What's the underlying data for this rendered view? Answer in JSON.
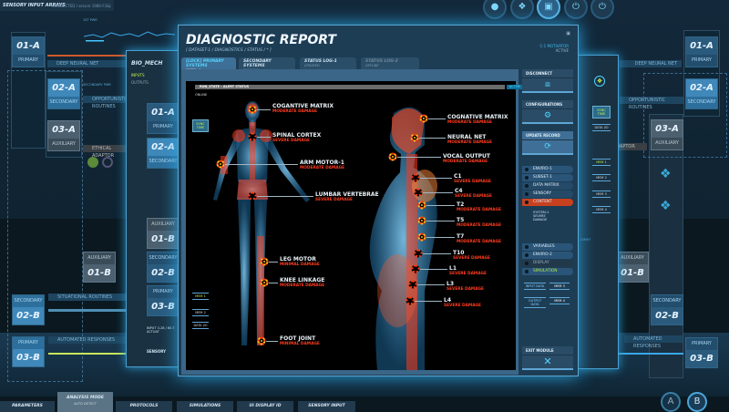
{
  "topbar": {
    "title": "SENSORY INPUT ARRAYS",
    "status": "CONNECTED / secure 1980-F3&J",
    "power_label": "1ST PWR"
  },
  "top_icons": [
    "user-icon",
    "diamond-icon",
    "document-icon",
    "power-icon",
    "power-icon"
  ],
  "left": {
    "tiles": [
      {
        "id": "01-A",
        "label": "PRIMARY"
      },
      {
        "id": "02-A",
        "label": "SECONDARY"
      },
      {
        "id": "03-A",
        "label": "AUXILIARY"
      },
      {
        "id": "01-B",
        "label": "AUXILIARY"
      },
      {
        "id": "02-B",
        "label": "SECONDARY"
      },
      {
        "id": "03-B",
        "label": "PRIMARY"
      }
    ],
    "strips": [
      "DEEP NEURAL NET",
      "OPPORTUNISTIC ROUTINES",
      "ETHICAL ADAPTOR",
      "SITUATIONAL ROUTINES",
      "AUTOMATED RESPONSES"
    ],
    "secondary_pwr": "SECONDARY PWR"
  },
  "bio_panel": {
    "title": "BIO_MECH",
    "inputs": "INPUTS",
    "outputs": "OUTPUTS",
    "footer": "SENSORY",
    "note": "INPUT 3-28 / 60-T ACTUAT"
  },
  "right": {
    "tiles": [
      {
        "id": "01-A",
        "label": "PRIMARY"
      },
      {
        "id": "02-A",
        "label": "SECONDARY"
      },
      {
        "id": "03-A",
        "label": "AUXILIARY"
      },
      {
        "id": "01-B",
        "label": "AUXILIARY"
      },
      {
        "id": "02-B",
        "label": "SECONDARY"
      },
      {
        "id": "03-B",
        "label": "PRIMARY"
      }
    ],
    "strips": [
      "DEEP NEURAL NET",
      "OPPORTUNISTIC ROUTINES",
      "ETHICAL ADAPTOR FORMULA",
      "AUTOMATED RESPONSES"
    ],
    "panel": {
      "sync": "SYNC TIME",
      "data": "DATA I/O",
      "mems": [
        "MEM 1",
        "MEM 2",
        "MEM 3",
        "MEM 4"
      ],
      "dim": "DIM97"
    }
  },
  "window": {
    "title": "DIAGNOSTIC REPORT",
    "breadcrumb": "[ DATASET-1 / DIAGNOSTICS / STATUS / * ]",
    "monitor": "C-1 MOTIVATOR",
    "monitor_state": "ACTIVE",
    "tabs": [
      {
        "label": "[LOCK] PRIMARY SYSTEMS",
        "sub": "MODE - 1"
      },
      {
        "label": "SECONDARY SYSTEMS",
        "sub": "RUNNING"
      },
      {
        "label": "STATUS LOG-1",
        "sub": "UPDATED"
      },
      {
        "label": "STATUS LOG-2",
        "sub": "OFFLINE"
      }
    ],
    "run_state": "RUN_STATE : ALERT STATUS",
    "active": "ACTIVE",
    "online": "ONLINE",
    "sync_time": "SYNC TIME",
    "mem1": "MEM 1",
    "mem2": "MEM 2",
    "data_io": "DATA I/O",
    "front": [
      {
        "name": "COGANTIVE MATRIX",
        "damage": "MODERATE DAMAGE"
      },
      {
        "name": "SPINAL CORTEX",
        "damage": "SEVERE DAMAGE"
      },
      {
        "name": "ARM MOTOR-1",
        "damage": "MODERATE DAMAGE"
      },
      {
        "name": "LUMBAR VERTEBRAE",
        "damage": "SEVERE DAMAGE"
      },
      {
        "name": "LEG MOTOR",
        "damage": "MINIMAL DAMAGE"
      },
      {
        "name": "KNEE LINKAGE",
        "damage": "MODERATE DAMAGE"
      },
      {
        "name": "FOOT  JOINT",
        "damage": "MINIMAL DAMAGE"
      }
    ],
    "side": [
      {
        "name": "COGNATIVE MATRIX",
        "damage": "MODERATE DAMAGE"
      },
      {
        "name": "NEURAL NET",
        "damage": "MODERATE DAMAGE"
      },
      {
        "name": "VOCAL OUTPUT",
        "damage": "MODERATE DAMAGE"
      },
      {
        "name": "C1",
        "damage": "SEVERE DAMAGE"
      },
      {
        "name": "C4",
        "damage": "SEVERE  DAMAGE"
      },
      {
        "name": "T2",
        "damage": "MODERATE DAMAGE"
      },
      {
        "name": "T5",
        "damage": "MODERATE DAMAGE"
      },
      {
        "name": "T7",
        "damage": "MODERATE DAMAGE"
      },
      {
        "name": "T10",
        "damage": "SEVERE  DAMAGE"
      },
      {
        "name": "L1",
        "damage": "SEVERE DAMAGE"
      },
      {
        "name": "L3",
        "damage": "SEVERE DAMAGE"
      },
      {
        "name": "L4",
        "damage": "SEVERE DAMAGE"
      }
    ],
    "sidebar": {
      "disconnect": "DISCONNECT",
      "configurations": "CONFIGURATIONS",
      "update": "UPDATE RECORD",
      "options1": [
        "ENVIRO-1",
        "SUBSET-1",
        "DATA MATRIX",
        "SENSORY",
        "CONTENT"
      ],
      "note": "SYSTEM-2 SEVERE DAMAGE",
      "options2": [
        "VARIABLES",
        "ENVIRO-2",
        "DISPLAY",
        "SIMULATION"
      ],
      "input_data": "INPUT DATA",
      "output_data": "OUTPUT DATA",
      "mem3": "MEM 3",
      "mem4": "MEM 4",
      "exit": "EXIT MODULE"
    }
  },
  "bottom": {
    "tabs": [
      "PARAMETERS",
      "ANALYSIS MODE",
      "PROTOCOLS",
      "SIMULATIONS",
      "UI DISPLAY ID",
      "SENSORY INPUT"
    ],
    "analysis_sub": "AUTO DETECT",
    "a": "A",
    "b": "B"
  }
}
